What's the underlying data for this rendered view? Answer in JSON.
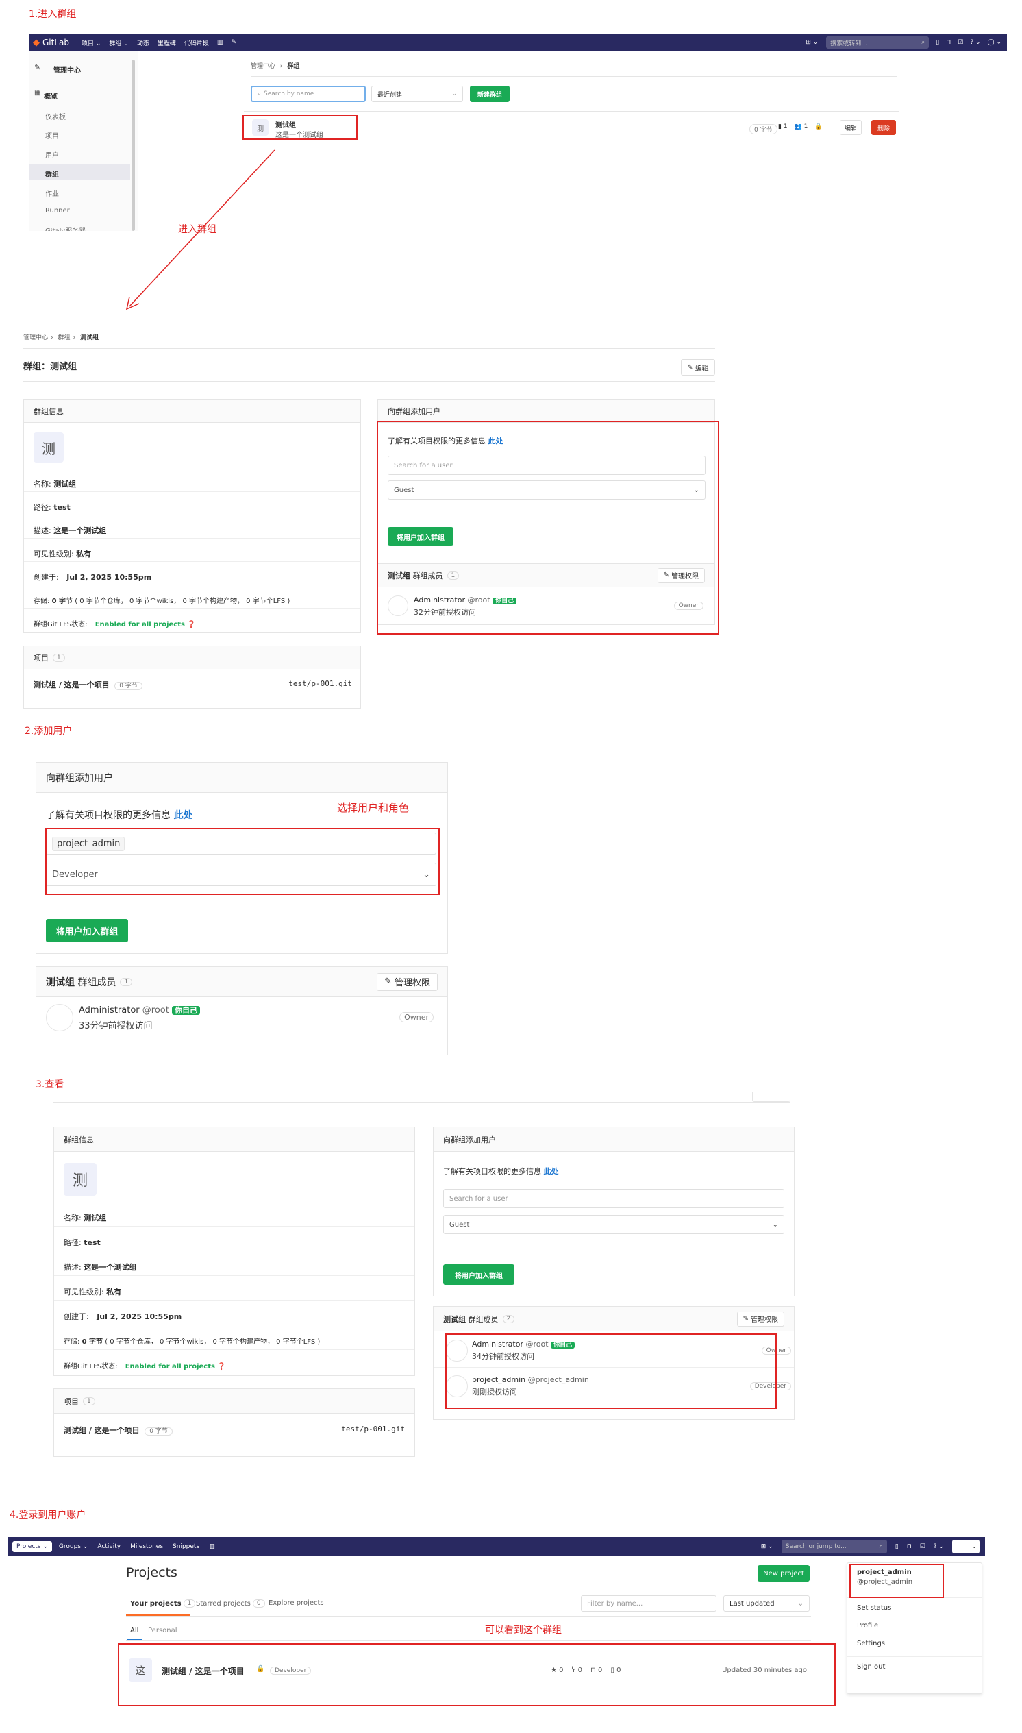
{
  "steps": {
    "s1": "1.进入群组",
    "s2": "2.添加用户",
    "s3": "3.查看",
    "s4": "4.登录到用户账户"
  },
  "annotations": {
    "enter_group": "进入群组",
    "select_user_role": "选择用户和角色",
    "can_see_group": "可以看到这个群组"
  },
  "colors": {
    "navbar": "#292961",
    "green": "#1aaa55",
    "red_annotation": "#e02424",
    "danger": "#db3b21"
  },
  "s1": {
    "nav": {
      "brand": "GitLab",
      "items": [
        "项目 ⌄",
        "群组 ⌄",
        "动态",
        "里程碑",
        "代码片段"
      ],
      "search_placeholder": "搜索或转到..."
    },
    "sidebar": {
      "title": "管理中心",
      "section": "概览",
      "items": [
        "仪表板",
        "项目",
        "用户",
        "群组",
        "作业",
        "Runner",
        "Gitaly服务器"
      ]
    },
    "breadcrumb": {
      "root": "管理中心",
      "current": "群组"
    },
    "search_placeholder": "Search by name",
    "sort": "最近创建",
    "new_group": "新建群组",
    "group": {
      "initial": "测",
      "name": "测试组",
      "desc": "这是一个测试组",
      "size": "0 字节",
      "projects": "1",
      "members": "1"
    },
    "edit": "编辑",
    "delete": "删除"
  },
  "s1b": {
    "breadcrumb": [
      "管理中心",
      "群组",
      "测试组"
    ],
    "title": "群组：测试组",
    "edit": "编辑",
    "info": {
      "header": "群组信息",
      "initial": "测",
      "name_label": "名称:",
      "name": "测试组",
      "path_label": "路径:",
      "path": "test",
      "desc_label": "描述:",
      "desc": "这是一个测试组",
      "vis_label": "可见性级别:",
      "vis": "私有",
      "created_label": "创建于:",
      "created": "Jul 2, 2025 10:55pm",
      "storage_label": "存储:",
      "storage": "0 字节",
      "storage_detail": "( 0 字节个仓库， 0 字节个wikis， 0 字节个构建产物， 0 字节个LFS )",
      "lfs_label": "群组Git LFS状态:",
      "lfs": "Enabled for all projects"
    },
    "projects": {
      "header": "项目",
      "count": "1",
      "name": "测试组 / 这是一个项目",
      "size": "0 字节",
      "path": "test/p-001.git"
    },
    "add_user": {
      "header": "向群组添加用户",
      "hint": "了解有关项目权限的更多信息",
      "hint_link": "此处",
      "search_placeholder": "Search for a user",
      "role": "Guest",
      "button": "将用户加入群组"
    },
    "members": {
      "header_group": "测试组",
      "header_label": "群组成员",
      "count": "1",
      "manage": "管理权限",
      "name": "Administrator",
      "handle": "@root",
      "you": "你自己",
      "access": "32分钟前授权访问",
      "role": "Owner"
    }
  },
  "s2": {
    "header": "向群组添加用户",
    "hint": "了解有关项目权限的更多信息",
    "hint_link": "此处",
    "user": "project_admin",
    "role": "Developer",
    "button": "将用户加入群组",
    "members": {
      "header_group": "测试组",
      "header_label": "群组成员",
      "count": "1",
      "manage": "管理权限",
      "name": "Administrator",
      "handle": "@root",
      "you": "你自己",
      "access": "33分钟前授权访问",
      "role": "Owner"
    }
  },
  "s3": {
    "info": {
      "header": "群组信息",
      "initial": "测",
      "name_label": "名称:",
      "name": "测试组",
      "path_label": "路径:",
      "path": "test",
      "desc_label": "描述:",
      "desc": "这是一个测试组",
      "vis_label": "可见性级别:",
      "vis": "私有",
      "created_label": "创建于:",
      "created": "Jul 2, 2025 10:55pm",
      "storage_label": "存储:",
      "storage": "0 字节",
      "storage_detail": "( 0 字节个仓库， 0 字节个wikis， 0 字节个构建产物， 0 字节个LFS )",
      "lfs_label": "群组Git LFS状态:",
      "lfs": "Enabled for all projects"
    },
    "projects": {
      "header": "项目",
      "count": "1",
      "name": "测试组 / 这是一个项目",
      "size": "0 字节",
      "path": "test/p-001.git"
    },
    "add_user": {
      "header": "向群组添加用户",
      "hint": "了解有关项目权限的更多信息",
      "hint_link": "此处",
      "search_placeholder": "Search for a user",
      "role": "Guest",
      "button": "将用户加入群组"
    },
    "members": {
      "header_group": "测试组",
      "header_label": "群组成员",
      "count": "2",
      "manage": "管理权限",
      "m1": {
        "name": "Administrator",
        "handle": "@root",
        "you": "你自己",
        "access": "34分钟前授权访问",
        "role": "Owner"
      },
      "m2": {
        "name": "project_admin",
        "handle": "@project_admin",
        "access": "刚刚授权访问",
        "role": "Developer"
      }
    }
  },
  "s4": {
    "nav": {
      "items": [
        "Projects ⌄",
        "Groups ⌄",
        "Activity",
        "Milestones",
        "Snippets"
      ],
      "search_placeholder": "Search or jump to..."
    },
    "title": "Projects",
    "new_project": "New project",
    "tabs": {
      "yours": "Your projects",
      "yours_count": "1",
      "starred": "Starred projects",
      "starred_count": "0",
      "explore": "Explore projects"
    },
    "filter_placeholder": "Filter by name...",
    "sort": "Last updated",
    "subtabs": {
      "all": "All",
      "personal": "Personal"
    },
    "project": {
      "initial": "这",
      "name": "测试组 / 这是一个项目",
      "role": "Developer",
      "stars": "0",
      "forks": "0",
      "mrs": "0",
      "issues": "0",
      "updated": "Updated 30 minutes ago"
    },
    "dropdown": {
      "user": "project_admin",
      "handle": "@project_admin",
      "items": [
        "Set status",
        "Profile",
        "Settings",
        "Sign out"
      ]
    }
  }
}
